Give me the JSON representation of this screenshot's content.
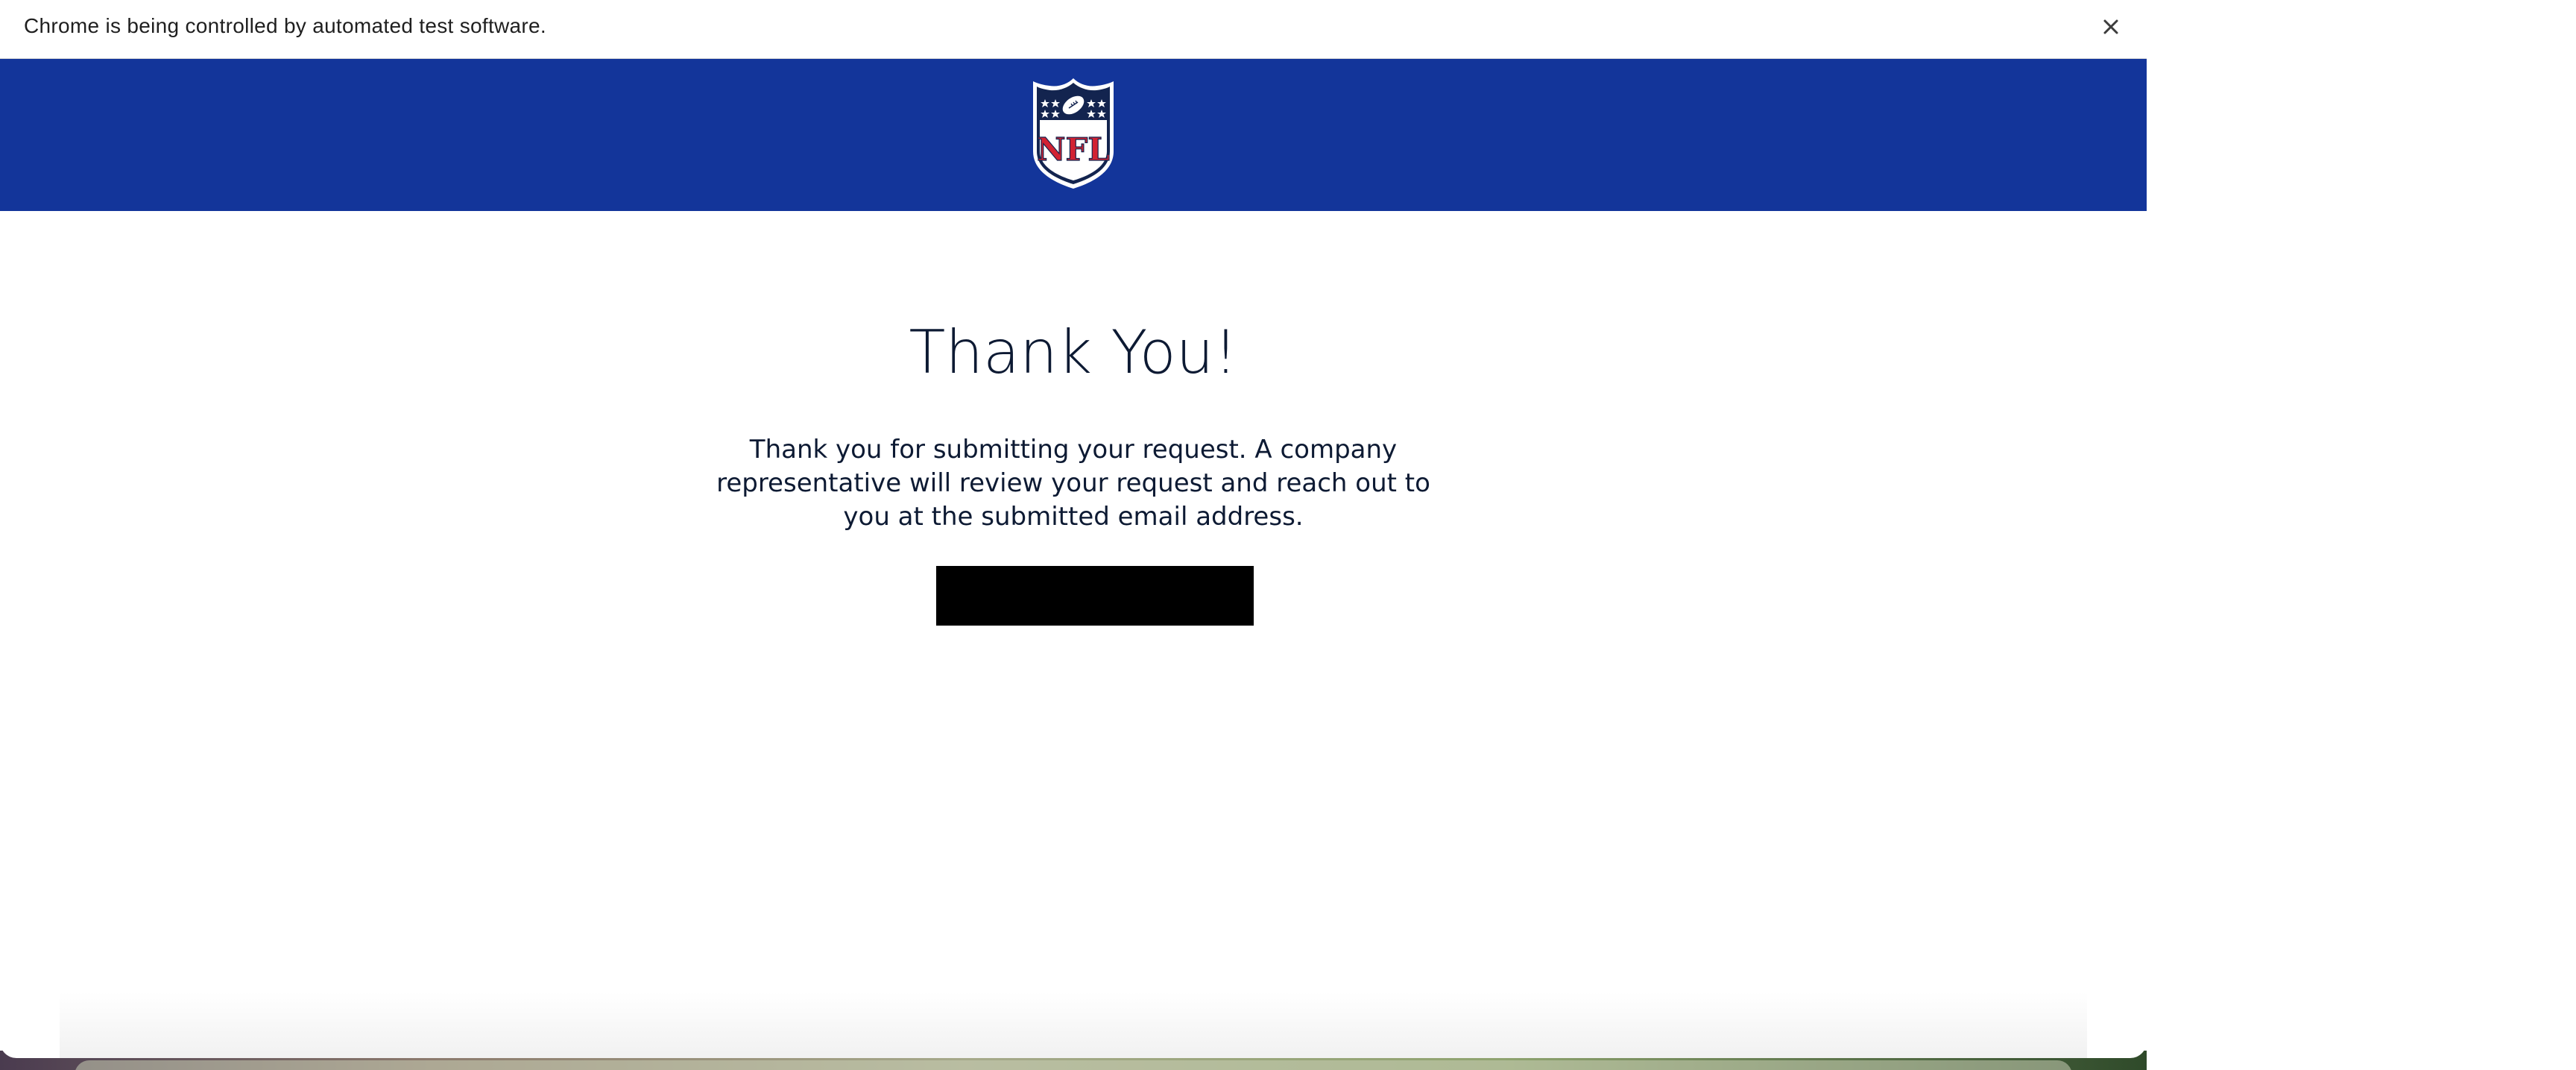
{
  "infobar": {
    "message": "Chrome is being controlled by automated test software.",
    "close_icon": "close-icon"
  },
  "header": {
    "logo_icon": "nfl-shield-logo",
    "logo_text": "NFL",
    "background_color": "#13359a"
  },
  "main": {
    "title": "Thank You!",
    "body": "Thank you for submitting your request. A company representative will review your request and reach out to you at the submitted email address."
  }
}
